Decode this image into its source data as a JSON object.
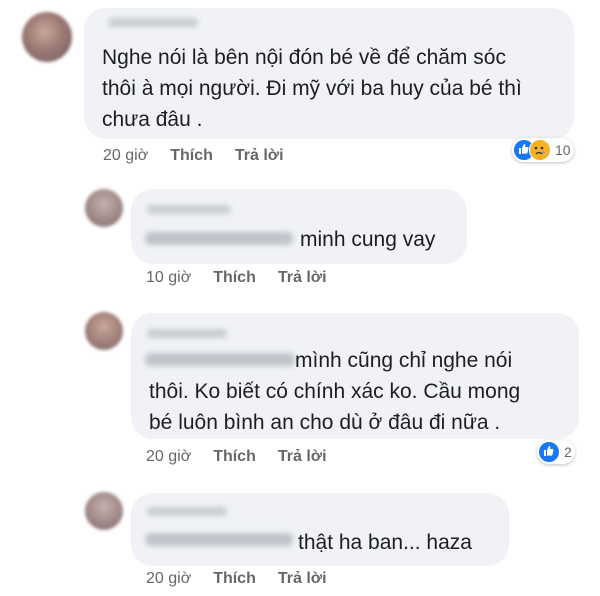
{
  "comments": [
    {
      "name_blurred": "Diễm Nguyễn",
      "lines": [
        "Nghe nói là bên nội đón bé về để chăm sóc",
        "thôi à mọi người. Đi mỹ với ba huy của bé thì",
        "chưa đâu ."
      ],
      "time": "20 giờ",
      "like": "Thích",
      "reply": "Trả lời",
      "reactions": {
        "count": "10",
        "icons": [
          "like-icon",
          "sad-icon"
        ]
      }
    },
    {
      "name_blurred": "Sang Huỳnh",
      "tag_blurred": "Diễm Nguyễn",
      "lines": [
        "minh cung vay"
      ],
      "time": "10 giờ",
      "like": "Thích",
      "reply": "Trả lời"
    },
    {
      "name_blurred": "Diễm Nguyễn",
      "tag_blurred": "Sang Huỳnh",
      "lines": [
        "mình cũng chỉ nghe nói",
        "thôi. Ko biết có chính xác ko. Cầu mong",
        "bé luôn bình an cho dù ở đâu đi nữa ."
      ],
      "time": "20 giờ",
      "like": "Thích",
      "reply": "Trả lời",
      "reactions": {
        "count": "2",
        "icons": [
          "like-icon"
        ]
      }
    },
    {
      "name_blurred": "Sang Huỳnh",
      "tag_blurred": "Diễm Nguyễn",
      "lines": [
        "thật ha ban... haza"
      ],
      "time": "20 giờ",
      "like": "Thích",
      "reply": "Trả lời"
    }
  ],
  "colors": {
    "bubble": "#f0f2f5",
    "meta": "#65676b",
    "like_blue": "#1877f2",
    "sad_yellow": "#f7b125"
  }
}
